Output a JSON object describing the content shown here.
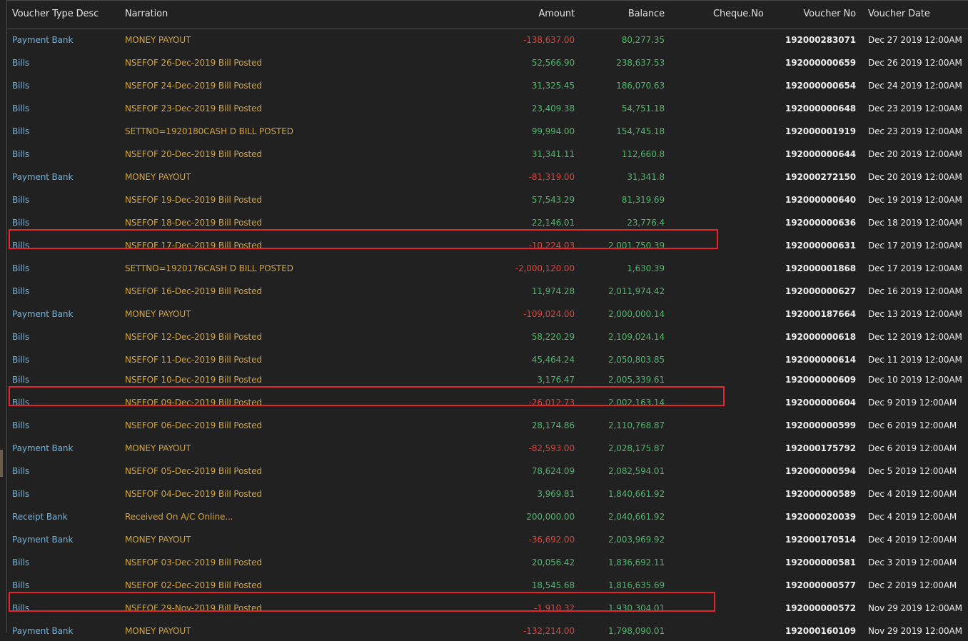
{
  "columns": {
    "type": "Voucher Type Desc",
    "narration": "Narration",
    "amount": "Amount",
    "balance": "Balance",
    "cheque": "Cheque.No",
    "voucher_no": "Voucher No",
    "voucher_date": "Voucher Date"
  },
  "colors": {
    "background": "#212121",
    "type_text": "#6fb3de",
    "narration_text": "#d3a33c",
    "positive_amount": "#4fb56c",
    "negative_amount": "#d9443d",
    "highlight_border": "#e3262d"
  },
  "rows": [
    {
      "type": "Payment Bank",
      "narration": "MONEY PAYOUT",
      "amount": "-138,637.00",
      "balance": "80,277.35",
      "cheque": "",
      "voucher_no": "192000283071",
      "voucher_date": "Dec 27 2019 12:00AM",
      "negative": true,
      "highlighted": false
    },
    {
      "type": "Bills",
      "narration": "NSEFOF 26-Dec-2019 Bill Posted",
      "amount": "52,566.90",
      "balance": "238,637.53",
      "cheque": "",
      "voucher_no": "192000000659",
      "voucher_date": "Dec 26 2019 12:00AM",
      "negative": false,
      "highlighted": false
    },
    {
      "type": "Bills",
      "narration": "NSEFOF 24-Dec-2019 Bill Posted",
      "amount": "31,325.45",
      "balance": "186,070.63",
      "cheque": "",
      "voucher_no": "192000000654",
      "voucher_date": "Dec 24 2019 12:00AM",
      "negative": false,
      "highlighted": false
    },
    {
      "type": "Bills",
      "narration": "NSEFOF 23-Dec-2019 Bill Posted",
      "amount": "23,409.38",
      "balance": "54,751.18",
      "cheque": "",
      "voucher_no": "192000000648",
      "voucher_date": "Dec 23 2019 12:00AM",
      "negative": false,
      "highlighted": false
    },
    {
      "type": "Bills",
      "narration": "SETTNO=1920180CASH D BILL POSTED",
      "amount": "99,994.00",
      "balance": "154,745.18",
      "cheque": "",
      "voucher_no": "192000001919",
      "voucher_date": "Dec 23 2019 12:00AM",
      "negative": false,
      "highlighted": false
    },
    {
      "type": "Bills",
      "narration": "NSEFOF 20-Dec-2019 Bill Posted",
      "amount": "31,341.11",
      "balance": "112,660.8",
      "cheque": "",
      "voucher_no": "192000000644",
      "voucher_date": "Dec 20 2019 12:00AM",
      "negative": false,
      "highlighted": false
    },
    {
      "type": "Payment Bank",
      "narration": "MONEY PAYOUT",
      "amount": "-81,319.00",
      "balance": "31,341.8",
      "cheque": "",
      "voucher_no": "192000272150",
      "voucher_date": "Dec 20 2019 12:00AM",
      "negative": true,
      "highlighted": false
    },
    {
      "type": "Bills",
      "narration": "NSEFOF 19-Dec-2019 Bill Posted",
      "amount": "57,543.29",
      "balance": "81,319.69",
      "cheque": "",
      "voucher_no": "192000000640",
      "voucher_date": "Dec 19 2019 12:00AM",
      "negative": false,
      "highlighted": false
    },
    {
      "type": "Bills",
      "narration": "NSEFOF 18-Dec-2019 Bill Posted",
      "amount": "22,146.01",
      "balance": "23,776.4",
      "cheque": "",
      "voucher_no": "192000000636",
      "voucher_date": "Dec 18 2019 12:00AM",
      "negative": false,
      "highlighted": false
    },
    {
      "type": "Bills",
      "narration": "NSEFOF 17-Dec-2019 Bill Posted",
      "amount": "-10,224.03",
      "balance": "2,001,750.39",
      "cheque": "",
      "voucher_no": "192000000631",
      "voucher_date": "Dec 17 2019 12:00AM",
      "negative": true,
      "highlighted": true
    },
    {
      "type": "Bills",
      "narration": "SETTNO=1920176CASH D BILL POSTED",
      "amount": "-2,000,120.00",
      "balance": "1,630.39",
      "cheque": "",
      "voucher_no": "192000001868",
      "voucher_date": "Dec 17 2019 12:00AM",
      "negative": true,
      "highlighted": false
    },
    {
      "type": "Bills",
      "narration": "NSEFOF 16-Dec-2019 Bill Posted",
      "amount": "11,974.28",
      "balance": "2,011,974.42",
      "cheque": "",
      "voucher_no": "192000000627",
      "voucher_date": "Dec 16 2019 12:00AM",
      "negative": false,
      "highlighted": false
    },
    {
      "type": "Payment Bank",
      "narration": "MONEY PAYOUT",
      "amount": "-109,024.00",
      "balance": "2,000,000.14",
      "cheque": "",
      "voucher_no": "192000187664",
      "voucher_date": "Dec 13 2019 12:00AM",
      "negative": true,
      "highlighted": false
    },
    {
      "type": "Bills",
      "narration": "NSEFOF 12-Dec-2019 Bill Posted",
      "amount": "58,220.29",
      "balance": "2,109,024.14",
      "cheque": "",
      "voucher_no": "192000000618",
      "voucher_date": "Dec 12 2019 12:00AM",
      "negative": false,
      "highlighted": false
    },
    {
      "type": "Bills",
      "narration": "NSEFOF 11-Dec-2019 Bill Posted",
      "amount": "45,464.24",
      "balance": "2,050,803.85",
      "cheque": "",
      "voucher_no": "192000000614",
      "voucher_date": "Dec 11 2019 12:00AM",
      "negative": false,
      "highlighted": false
    },
    {
      "type": "Bills",
      "narration": "NSEFOF 10-Dec-2019 Bill Posted",
      "amount": "3,176.47",
      "balance": "2,005,339.61",
      "cheque": "",
      "voucher_no": "192000000609",
      "voucher_date": "Dec 10 2019 12:00AM",
      "negative": false,
      "highlighted": false
    },
    {
      "type": "Bills",
      "narration": "NSEFOF 09-Dec-2019 Bill Posted",
      "amount": "-26,012.73",
      "balance": "2,002,163.14",
      "cheque": "",
      "voucher_no": "192000000604",
      "voucher_date": "Dec 9 2019 12:00AM",
      "negative": true,
      "highlighted": true
    },
    {
      "type": "Bills",
      "narration": "NSEFOF 06-Dec-2019 Bill Posted",
      "amount": "28,174.86",
      "balance": "2,110,768.87",
      "cheque": "",
      "voucher_no": "192000000599",
      "voucher_date": "Dec 6 2019 12:00AM",
      "negative": false,
      "highlighted": false
    },
    {
      "type": "Payment Bank",
      "narration": "MONEY PAYOUT",
      "amount": "-82,593.00",
      "balance": "2,028,175.87",
      "cheque": "",
      "voucher_no": "192000175792",
      "voucher_date": "Dec 6 2019 12:00AM",
      "negative": true,
      "highlighted": false
    },
    {
      "type": "Bills",
      "narration": "NSEFOF 05-Dec-2019 Bill Posted",
      "amount": "78,624.09",
      "balance": "2,082,594.01",
      "cheque": "",
      "voucher_no": "192000000594",
      "voucher_date": "Dec 5 2019 12:00AM",
      "negative": false,
      "highlighted": false
    },
    {
      "type": "Bills",
      "narration": "NSEFOF 04-Dec-2019 Bill Posted",
      "amount": "3,969.81",
      "balance": "1,840,661.92",
      "cheque": "",
      "voucher_no": "192000000589",
      "voucher_date": "Dec 4 2019 12:00AM",
      "negative": false,
      "highlighted": false
    },
    {
      "type": "Receipt Bank",
      "narration": "Received On A/C Online...",
      "amount": "200,000.00",
      "balance": "2,040,661.92",
      "cheque": "",
      "voucher_no": "192000020039",
      "voucher_date": "Dec 4 2019 12:00AM",
      "negative": false,
      "highlighted": false
    },
    {
      "type": "Payment Bank",
      "narration": "MONEY PAYOUT",
      "amount": "-36,692.00",
      "balance": "2,003,969.92",
      "cheque": "",
      "voucher_no": "192000170514",
      "voucher_date": "Dec 4 2019 12:00AM",
      "negative": true,
      "highlighted": false
    },
    {
      "type": "Bills",
      "narration": "NSEFOF 03-Dec-2019 Bill Posted",
      "amount": "20,056.42",
      "balance": "1,836,692.11",
      "cheque": "",
      "voucher_no": "192000000581",
      "voucher_date": "Dec 3 2019 12:00AM",
      "negative": false,
      "highlighted": false
    },
    {
      "type": "Bills",
      "narration": "NSEFOF 02-Dec-2019 Bill Posted",
      "amount": "18,545.68",
      "balance": "1,816,635.69",
      "cheque": "",
      "voucher_no": "192000000577",
      "voucher_date": "Dec 2 2019 12:00AM",
      "negative": false,
      "highlighted": false
    },
    {
      "type": "Bills",
      "narration": "NSEFOF 29-Nov-2019 Bill Posted",
      "amount": "-1,910.32",
      "balance": "1,930,304.01",
      "cheque": "",
      "voucher_no": "192000000572",
      "voucher_date": "Nov 29 2019 12:00AM",
      "negative": true,
      "highlighted": true
    },
    {
      "type": "Payment Bank",
      "narration": "MONEY PAYOUT",
      "amount": "-132,214.00",
      "balance": "1,798,090.01",
      "cheque": "",
      "voucher_no": "192000160109",
      "voucher_date": "Nov 29 2019 12:00AM",
      "negative": true,
      "highlighted": false
    }
  ]
}
